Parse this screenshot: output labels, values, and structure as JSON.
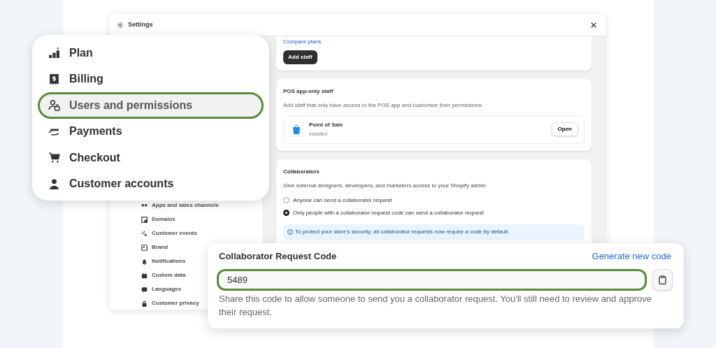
{
  "window": {
    "title": "Settings"
  },
  "sidebar": {
    "items": [
      {
        "label": "Apps and sales channels"
      },
      {
        "label": "Domains"
      },
      {
        "label": "Customer events"
      },
      {
        "label": "Brand"
      },
      {
        "label": "Notifications"
      },
      {
        "label": "Custom data"
      },
      {
        "label": "Languages"
      },
      {
        "label": "Customer privacy"
      }
    ]
  },
  "staff_card": {
    "link": "Compare plans.",
    "button": "Add staff"
  },
  "pos_card": {
    "title": "POS app-only staff",
    "description": "Add staff that only have access to the POS app and customize their permissions",
    "app": {
      "name": "Point of Sale",
      "status": "Installed",
      "button": "Open"
    }
  },
  "collaborators_card": {
    "title": "Collaborators",
    "description": "Give external designers, developers, and marketers access to your Shopify admin",
    "options": [
      {
        "label": "Anyone can send a collaborator request",
        "selected": false
      },
      {
        "label": "Only people with a collaborator request code can send a collaborator request",
        "selected": true
      }
    ],
    "banner": "To protect your store's security, all collaborator requests now require a code by default."
  },
  "popup_menu": {
    "items": [
      {
        "label": "Plan",
        "selected": false
      },
      {
        "label": "Billing",
        "selected": false
      },
      {
        "label": "Users and permissions",
        "selected": true
      },
      {
        "label": "Payments",
        "selected": false
      },
      {
        "label": "Checkout",
        "selected": false
      },
      {
        "label": "Customer accounts",
        "selected": false
      }
    ]
  },
  "code_panel": {
    "title": "Collaborator Request Code",
    "link": "Generate new code",
    "value": "5489",
    "help": "Share this code to allow someone to send you a collaborator request. You'll still need to review and approve their request."
  }
}
